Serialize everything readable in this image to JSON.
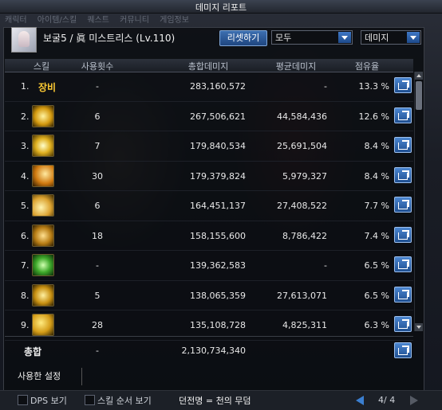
{
  "window": {
    "title": "데미지 리포트"
  },
  "top_tabs": [
    "캐릭터",
    "아이템/스킬",
    "퀘스트",
    "커뮤니티",
    "게임정보"
  ],
  "character": {
    "name": "보굴5 / 眞 미스트리스 (Lv.110)"
  },
  "toolbar": {
    "reset_label": "리셋하기",
    "filter_value": "모두",
    "metric_value": "데미지"
  },
  "table": {
    "headers": {
      "skill": "스킬",
      "uses": "사용횟수",
      "total": "총합데미지",
      "avg": "평균데미지",
      "share": "점유율"
    },
    "rows": [
      {
        "rank": "1.",
        "skill": "장비",
        "uses": "-",
        "total": "283,160,572",
        "avg": "-",
        "share": "13.3 %"
      },
      {
        "rank": "2.",
        "skill": "",
        "uses": "6",
        "total": "267,506,621",
        "avg": "44,584,436",
        "share": "12.6 %"
      },
      {
        "rank": "3.",
        "skill": "",
        "uses": "7",
        "total": "179,840,534",
        "avg": "25,691,504",
        "share": "8.4 %"
      },
      {
        "rank": "4.",
        "skill": "",
        "uses": "30",
        "total": "179,379,824",
        "avg": "5,979,327",
        "share": "8.4 %"
      },
      {
        "rank": "5.",
        "skill": "",
        "uses": "6",
        "total": "164,451,137",
        "avg": "27,408,522",
        "share": "7.7 %"
      },
      {
        "rank": "6.",
        "skill": "",
        "uses": "18",
        "total": "158,155,600",
        "avg": "8,786,422",
        "share": "7.4 %"
      },
      {
        "rank": "7.",
        "skill": "",
        "uses": "-",
        "total": "139,362,583",
        "avg": "-",
        "share": "6.5 %"
      },
      {
        "rank": "8.",
        "skill": "",
        "uses": "5",
        "total": "138,065,359",
        "avg": "27,613,071",
        "share": "6.5 %"
      },
      {
        "rank": "9.",
        "skill": "",
        "uses": "28",
        "total": "135,108,728",
        "avg": "4,825,311",
        "share": "6.3 %"
      }
    ],
    "totals": {
      "label": "총합",
      "uses": "-",
      "total": "2,130,734,340"
    }
  },
  "used_settings_label": "사용한 설정",
  "bottom": {
    "dps_label": "DPS 보기",
    "skill_order_label": "스킬 순서 보기",
    "zone": "던전명 = 천의 무덤",
    "page": "4/ 4"
  }
}
